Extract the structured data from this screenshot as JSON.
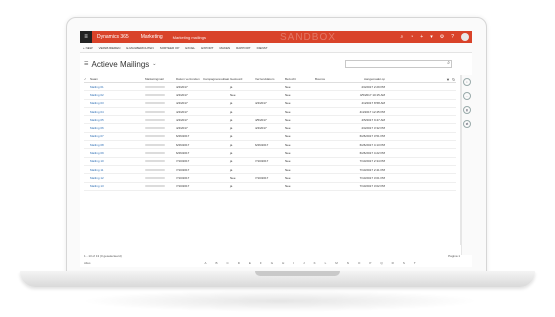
{
  "navbar": {
    "app_name": "Dynamics 365",
    "area": "Marketing",
    "page": "Marketing mailings",
    "watermark": "SANDBOX",
    "icons": [
      "search-icon",
      "task-icon",
      "plus-icon",
      "filter-icon",
      "gear-icon",
      "help-icon",
      "avatar"
    ]
  },
  "commands": [
    "+ NEW",
    "VERWIJDEREN",
    "E-MAILBERICHTEN",
    "SORTEER OP",
    "EXCEL",
    "EXPORT",
    "MAKEN",
    "RAPPORT",
    "DIENST"
  ],
  "view": {
    "title": "Actieve Mailings",
    "search_placeholder": "Search for records"
  },
  "grid": {
    "columns": [
      "Naam",
      "Marketingmail",
      "Datum verzonden",
      "Campagneresultaat",
      "Gestuurd",
      "Verzenddatum",
      "Bezocht",
      "Bounce",
      "Aangemaakt op"
    ],
    "rows": [
      {
        "name": "Mailing 01",
        "d1": "4/4/2017",
        "status": "ja",
        "d2": "",
        "flag": "Nee",
        "created": "4/4/2017 2:29 PM"
      },
      {
        "name": "Mailing 02",
        "d1": "4/4/2017",
        "status": "Nee",
        "d2": "",
        "flag": "Nee",
        "created": "4/5/2017 10:15 AM"
      },
      {
        "name": "Mailing 03",
        "d1": "4/4/2017",
        "status": "ja",
        "d2": "4/4/2017",
        "flag": "Nee",
        "created": "4/4/2017 8:58 AM"
      },
      {
        "name": "Mailing 04",
        "d1": "4/4/2017",
        "status": "ja",
        "d2": "",
        "flag": "Nee",
        "created": "4/4/2017 12:45 PM"
      },
      {
        "name": "Mailing 05",
        "d1": "4/4/2017",
        "status": "ja",
        "d2": "4/5/2017",
        "flag": "Nee",
        "created": "4/5/2017 9:47 AM"
      },
      {
        "name": "Mailing 06",
        "d1": "4/4/2017",
        "status": "ja",
        "d2": "4/4/2017",
        "flag": "Nee",
        "created": "4/4/2017 3:32 PM"
      },
      {
        "name": "Mailing 07",
        "d1": "6/26/2017",
        "status": "ja",
        "d2": "",
        "flag": "Nee",
        "created": "6/26/2017 3:51 PM"
      },
      {
        "name": "Mailing 08",
        "d1": "6/26/2017",
        "status": "ja",
        "d2": "6/26/2017",
        "flag": "Nee",
        "created": "6/26/2017 4:13 PM"
      },
      {
        "name": "Mailing 09",
        "d1": "6/26/2017",
        "status": "ja",
        "d2": "",
        "flag": "Nee",
        "created": "6/26/2017 4:22 PM"
      },
      {
        "name": "Mailing 10",
        "d1": "7/10/2017",
        "status": "ja",
        "d2": "7/10/2017",
        "flag": "Nee",
        "created": "7/10/2017 2:34 PM"
      },
      {
        "name": "Mailing 11",
        "d1": "7/10/2017",
        "status": "ja",
        "d2": "",
        "flag": "Nee",
        "created": "7/10/2017 2:41 PM"
      },
      {
        "name": "Mailing 12",
        "d1": "7/10/2017",
        "status": "Nee",
        "d2": "7/10/2017",
        "flag": "Nee",
        "created": "7/10/2017 3:01 PM"
      },
      {
        "name": "Mailing 13",
        "d1": "7/10/2017",
        "status": "ja",
        "d2": "",
        "flag": "Nee",
        "created": "7/10/2017 3:02 PM"
      }
    ]
  },
  "footer": {
    "count": "1 - 13 of 13 (0 geselecteerd)",
    "page": "Pagina 1"
  },
  "alpha": {
    "label": "Alles",
    "letters": [
      "A",
      "B",
      "C",
      "D",
      "E",
      "F",
      "G",
      "H",
      "I",
      "J",
      "K",
      "L",
      "M",
      "N",
      "O",
      "P",
      "Q",
      "R",
      "S",
      "T"
    ]
  },
  "side_icons": [
    "info-icon",
    "chat-icon",
    "chart-icon",
    "share-icon"
  ]
}
